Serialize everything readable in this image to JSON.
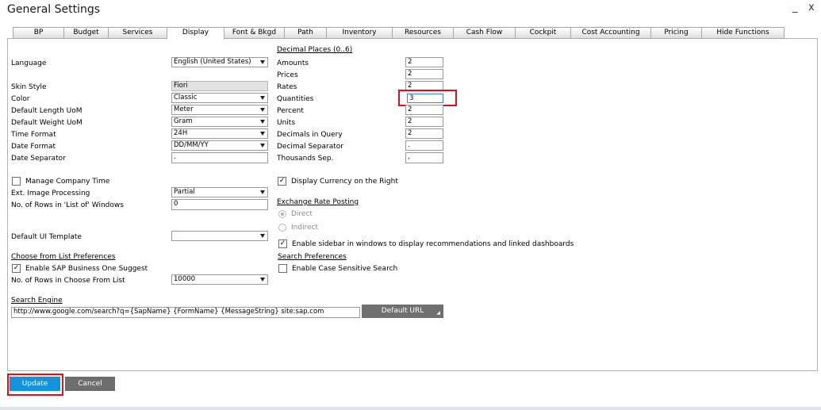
{
  "window": {
    "title": "General Settings",
    "minimize_glyph": "_",
    "close_glyph": "x"
  },
  "tabs": [
    "BP",
    "Budget",
    "Services",
    "Display",
    "Font & Bkgd",
    "Path",
    "Inventory",
    "Resources",
    "Cash Flow",
    "Cockpit",
    "Cost Accounting",
    "Pricing",
    "Hide Functions"
  ],
  "active_tab": "Display",
  "left": {
    "language": {
      "label": "Language",
      "value": "English (United States)"
    },
    "skin_style": {
      "label": "Skin Style",
      "value": "Fiori"
    },
    "color": {
      "label": "Color",
      "value": "Classic"
    },
    "length_uom": {
      "label": "Default Length UoM",
      "value": "Meter"
    },
    "weight_uom": {
      "label": "Default Weight UoM",
      "value": "Gram"
    },
    "time_format": {
      "label": "Time Format",
      "value": "24H"
    },
    "date_format": {
      "label": "Date Format",
      "value": "DD/MM/YY"
    },
    "date_separator": {
      "label": "Date Separator",
      "value": "."
    },
    "manage_company_time": {
      "label": "Manage Company Time",
      "checked": false
    },
    "ext_image": {
      "label": "Ext. Image Processing",
      "value": "Partial"
    },
    "rows_list_of": {
      "label": "No. of Rows in 'List of' Windows",
      "value": "0"
    },
    "ui_template": {
      "label": "Default UI Template",
      "value": ""
    },
    "cfl_title": "Choose from List Preferences",
    "enable_suggest": {
      "label": "Enable SAP Business One Suggest",
      "checked": true
    },
    "rows_cfl": {
      "label": "No. of Rows in Choose From List",
      "value": "10000"
    },
    "search_engine": {
      "label": "Search Engine",
      "value": "http://www.google.com/search?q={SapName} {FormName} {MessageString} site:sap.com"
    },
    "default_url_button": "Default URL"
  },
  "right": {
    "decimal_title": "Decimal Places  (0..6)",
    "decimals": [
      {
        "label": "Amounts",
        "value": "2"
      },
      {
        "label": "Prices",
        "value": "2"
      },
      {
        "label": "Rates",
        "value": "2"
      },
      {
        "label": "Quantities",
        "value": "3"
      },
      {
        "label": "Percent",
        "value": "2"
      },
      {
        "label": "Units",
        "value": "2"
      },
      {
        "label": "Decimals in Query",
        "value": "2"
      },
      {
        "label": "Decimal Separator",
        "value": "."
      },
      {
        "label": "Thousands Sep.",
        "value": ","
      }
    ],
    "display_currency_right": {
      "label": "Display Currency on the Right",
      "checked": true
    },
    "exchange_title": "Exchange Rate Posting",
    "direct": {
      "label": "Direct",
      "selected": true
    },
    "indirect": {
      "label": "Indirect",
      "selected": false
    },
    "enable_sidebar": {
      "label": "Enable sidebar in windows to display recommendations and linked dashboards",
      "checked": true
    },
    "search_pref_title": "Search Preferences",
    "case_sensitive": {
      "label": "Enable Case Sensitive Search",
      "checked": false
    }
  },
  "footer": {
    "update": "Update",
    "cancel": "Cancel"
  },
  "colors": {
    "update_button": "#1592d9",
    "cancel_button": "#6e6e6e",
    "highlight": "#e0101a",
    "default_url_button": "#707070"
  }
}
